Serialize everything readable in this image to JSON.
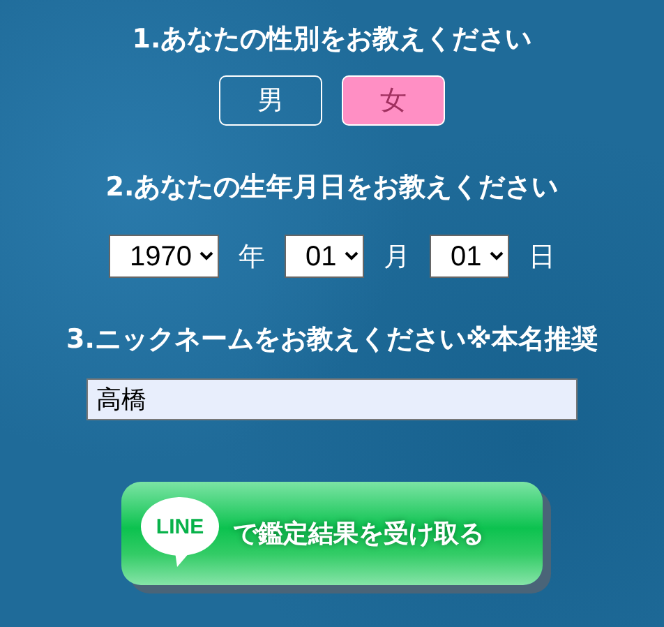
{
  "questions": [
    {
      "title": "1.あなたの性別をお教えください",
      "kind": "gender",
      "options": [
        {
          "label": "男",
          "selected": false
        },
        {
          "label": "女",
          "selected": true
        }
      ]
    },
    {
      "title": "2.あなたの生年月日をお教えください",
      "kind": "birthday",
      "fields": [
        {
          "value": "1970",
          "unit": "年"
        },
        {
          "value": "01",
          "unit": "月"
        },
        {
          "value": "01",
          "unit": "日"
        }
      ]
    },
    {
      "title": "3.ニックネームをお教えください※本名推奨",
      "kind": "name",
      "value": "高橋"
    }
  ],
  "submit": {
    "logo_text": "LINE",
    "label": "で鑑定結果を受け取る"
  }
}
